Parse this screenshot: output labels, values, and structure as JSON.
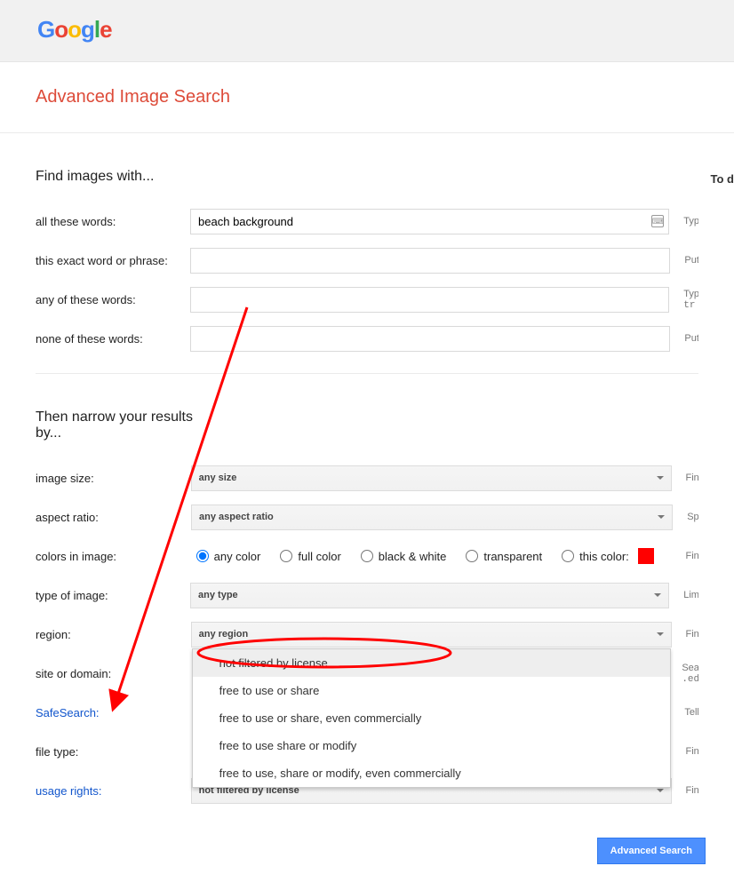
{
  "header": {
    "logo_text": "Google"
  },
  "title": "Advanced Image Search",
  "to_do_label": "To d",
  "find_section": {
    "title": "Find images with...",
    "all_words": {
      "label": "all these words:",
      "value": "beach background",
      "hint": "Typ"
    },
    "exact_phrase": {
      "label": "this exact word or phrase:",
      "value": "",
      "hint": "Put"
    },
    "any_words": {
      "label": "any of these words:",
      "value": "",
      "hint1": "Typ",
      "hint2": "tr"
    },
    "none_words": {
      "label": "none of these words:",
      "value": "",
      "hint": "Put"
    }
  },
  "narrow_section": {
    "title": "Then narrow your results by...",
    "image_size": {
      "label": "image size:",
      "value": "any size",
      "hint": "Fin"
    },
    "aspect_ratio": {
      "label": "aspect ratio:",
      "value": "any aspect ratio",
      "hint": "Sp"
    },
    "colors": {
      "label": "colors in image:",
      "hint": "Fin",
      "options": {
        "any": "any color",
        "full": "full color",
        "bw": "black & white",
        "transparent": "transparent",
        "this": "this color:"
      },
      "swatch_color": "#ff0000"
    },
    "type": {
      "label": "type of image:",
      "value": "any type",
      "hint": "Lim"
    },
    "region": {
      "label": "region:",
      "value": "any region",
      "hint": "Fin",
      "options": [
        "not filtered by license",
        "free to use or share",
        "free to use or share, even commercially",
        "free to use share or modify",
        "free to use, share or modify, even commercially"
      ]
    },
    "site": {
      "label": "site or domain:",
      "hint1": "Sea",
      "hint2": ".ed"
    },
    "safesearch": {
      "label": "SafeSearch:",
      "hint": "Tell"
    },
    "file_type": {
      "label": "file type:",
      "hint": "Fin"
    },
    "usage_rights": {
      "label": "usage rights:",
      "value": "not filtered by license",
      "hint": "Fin"
    }
  },
  "button": {
    "submit": "Advanced Search"
  }
}
